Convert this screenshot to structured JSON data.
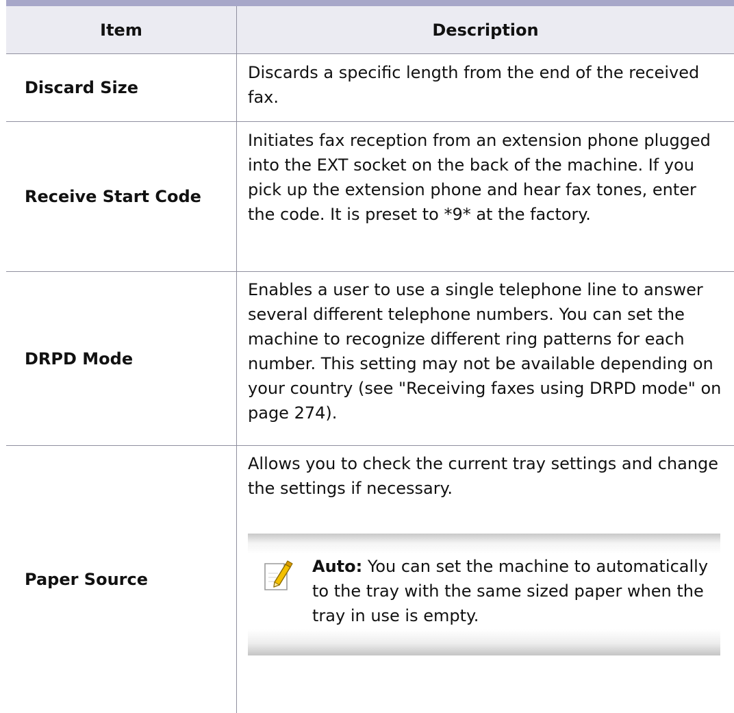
{
  "header": {
    "item_label": "Item",
    "description_label": "Description"
  },
  "rows": [
    {
      "item": "Discard Size",
      "description": "Discards a specific length from the end of the received fax."
    },
    {
      "item": "Receive Start Code",
      "description": "Initiates fax reception from an extension phone plugged into the EXT socket on the back of the machine. If you pick up the extension phone and hear fax tones, enter the code. It is preset to *9* at the factory."
    },
    {
      "item": "DRPD Mode",
      "description": "Enables a user to use a single telephone line to answer several different telephone numbers. You can set the machine to recognize different ring patterns for each number. This setting may not be available depending on your country (see \"Receiving faxes using DRPD mode\" on page 274)."
    },
    {
      "item": "Paper Source",
      "description": "Allows you to check the current tray settings and change the settings if necessary.",
      "note": {
        "icon": "note-pencil-icon",
        "label": "Auto:",
        "text": " You can set the machine to automatically to the tray with the same sized paper when the tray in use is empty."
      }
    }
  ],
  "colors": {
    "top_rule": "#a7a7c9",
    "header_background": "#ebebf2",
    "note_icon_accent": "#f0b400"
  }
}
